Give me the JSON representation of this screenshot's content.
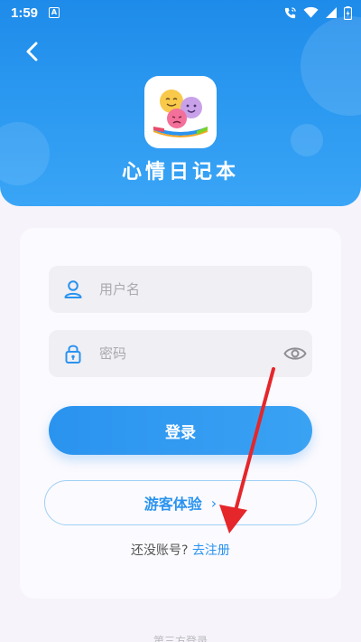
{
  "status_bar": {
    "time": "1:59",
    "notification_glyph": "A",
    "icons": [
      "phone-call-icon",
      "wifi-icon",
      "signal-icon",
      "battery-icon"
    ]
  },
  "header": {
    "app_title": "心情日记本",
    "back_icon": "back-arrow-icon"
  },
  "login_form": {
    "username": {
      "placeholder": "用户名",
      "value": "",
      "icon": "user-icon"
    },
    "password": {
      "placeholder": "密码",
      "value": "",
      "icon": "lock-icon",
      "toggle_icon": "eye-icon"
    },
    "login_label": "登录",
    "guest_label": "游客体验",
    "guest_chevron": "›",
    "no_account_text": "还没账号?",
    "register_link": "去注册"
  },
  "footer": {
    "third_party_label": "第三方登录"
  },
  "colors": {
    "primary": "#2a93ef",
    "header_gradient_top": "#1e8bea",
    "annotation_arrow": "#e5262a"
  }
}
